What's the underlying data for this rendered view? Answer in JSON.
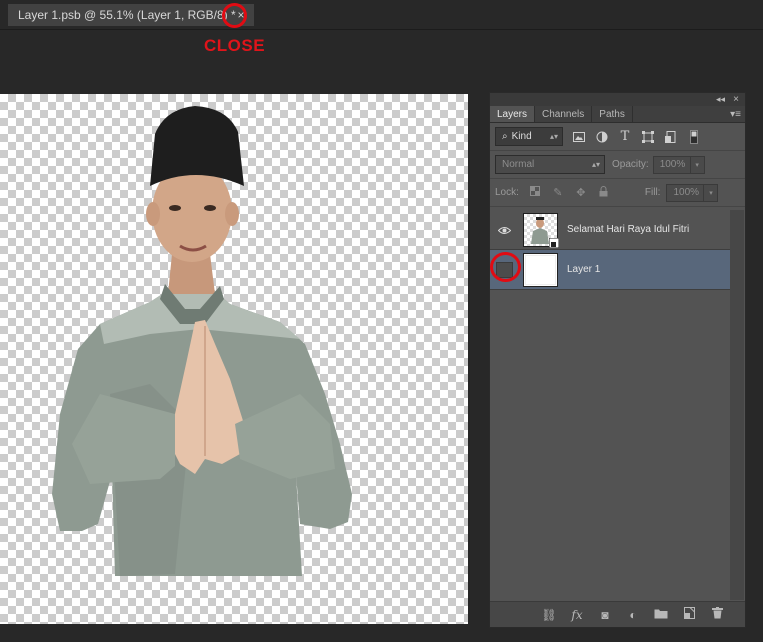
{
  "document": {
    "tab_title": "Layer 1.psb @ 55.1% (Layer 1, RGB/8) *",
    "close_glyph": "×"
  },
  "annotation": {
    "close_label": "CLOSE",
    "color": "#e10b13"
  },
  "layers_panel": {
    "collapse_glyph": "◂◂",
    "close_glyph": "×",
    "menu_glyph": "▾≡",
    "tabs": [
      {
        "label": "Layers",
        "active": true
      },
      {
        "label": "Channels",
        "active": false
      },
      {
        "label": "Paths",
        "active": false
      }
    ],
    "filter": {
      "kind_label": "Kind",
      "search_glyph": "⌕",
      "arrows": "▴▾",
      "icons": [
        "image-filter-icon",
        "adjustment-filter-icon",
        "type-filter-icon",
        "shape-filter-icon",
        "smart-object-filter-icon",
        "filter-toggle-icon"
      ]
    },
    "blend_mode": "Normal",
    "opacity_label": "Opacity:",
    "opacity_value": "100%",
    "lock_label": "Lock:",
    "fill_label": "Fill:",
    "fill_value": "100%",
    "dropdown_arrow": "▾",
    "layers": [
      {
        "name": "Selamat Hari Raya Idul Fitri",
        "visible": true,
        "selected": false,
        "eye": "👁"
      },
      {
        "name": "Layer 1",
        "visible": false,
        "selected": true,
        "eye": ""
      }
    ],
    "footer_icons": {
      "link": "⛓",
      "fx": "fx",
      "mask": "◙",
      "adjust": "◐",
      "group": "▬",
      "new": "▣",
      "trash": "🗑"
    }
  },
  "colors": {
    "accent_red": "#e10b13",
    "selected_layer": "#58677b",
    "panel_bg": "#535353",
    "app_bg": "#282828"
  }
}
